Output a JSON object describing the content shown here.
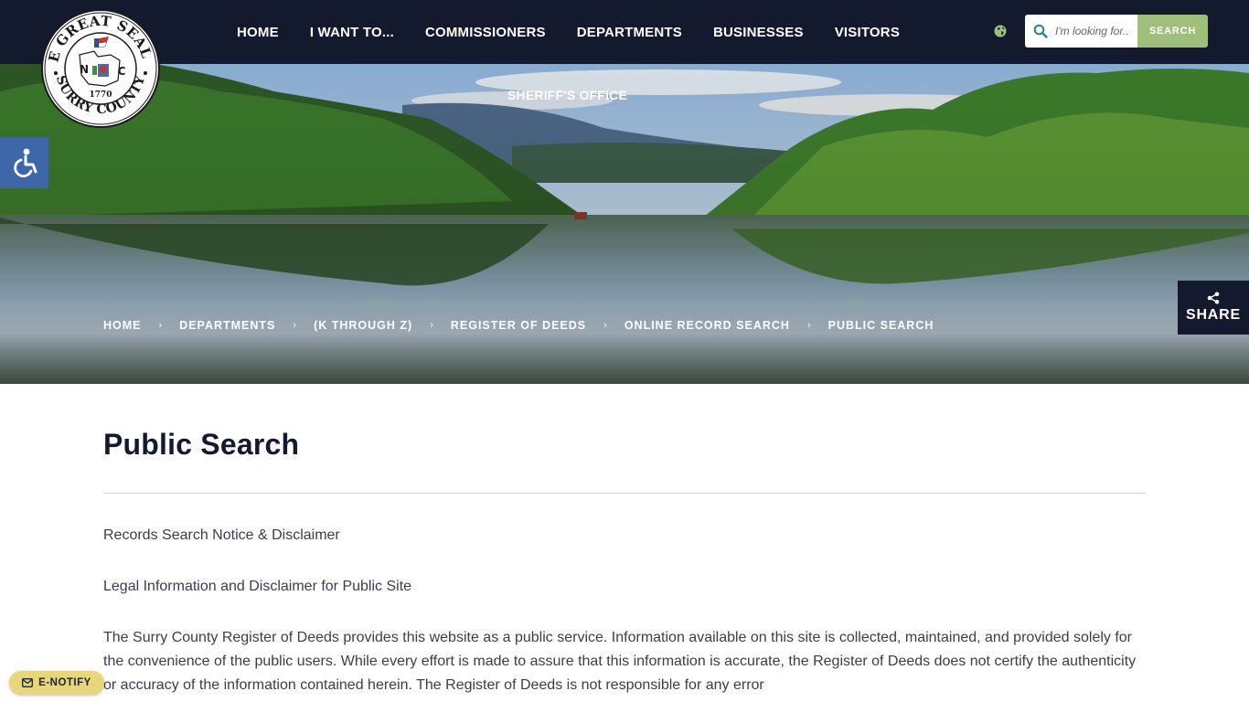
{
  "header": {
    "nav": [
      {
        "label": "HOME"
      },
      {
        "label": "I WANT TO..."
      },
      {
        "label": "COMMISSIONERS"
      },
      {
        "label": "DEPARTMENTS"
      },
      {
        "label": "BUSINESSES"
      },
      {
        "label": "VISITORS"
      }
    ],
    "nav_second_row": "SHERIFF'S OFFICE",
    "search": {
      "placeholder": "I'm looking for...",
      "button": "SEARCH"
    }
  },
  "seal": {
    "top_text": "THE GREAT SEAL OF",
    "bottom_text": "SURRY COUNTY",
    "left_letter": "N",
    "right_letter": "C",
    "year": "1770"
  },
  "share": {
    "label": "SHARE"
  },
  "breadcrumb": [
    {
      "label": "HOME"
    },
    {
      "label": "DEPARTMENTS"
    },
    {
      "label": "(K THROUGH Z)"
    },
    {
      "label": "REGISTER OF DEEDS"
    },
    {
      "label": "ONLINE RECORD SEARCH"
    },
    {
      "label": "PUBLIC SEARCH"
    }
  ],
  "content": {
    "title": "Public Search",
    "paragraphs": [
      "Records Search Notice & Disclaimer",
      "Legal Information and Disclaimer for Public Site",
      "The Surry County Register of Deeds provides this website as a public service.  Information available on this site is collected, maintained, and provided solely for the convenience of the public users.  While every effort is made to assure that this information is accurate, the Register of Deeds does not certify the authenticity or accuracy of the information contained herein.  The Register of Deeds is not responsible for any error"
    ]
  },
  "enotify": {
    "label": "E-NOTIFY"
  },
  "colors": {
    "header_bg": "#141a2e",
    "search_button": "#9ec07b",
    "accessibility": "#3d67a8",
    "enotify": "#e8d77a"
  },
  "icons": {
    "globe": "globe-icon",
    "search": "search-icon",
    "accessibility": "wheelchair-icon",
    "share": "share-icon",
    "enotify": "envelope-icon"
  }
}
